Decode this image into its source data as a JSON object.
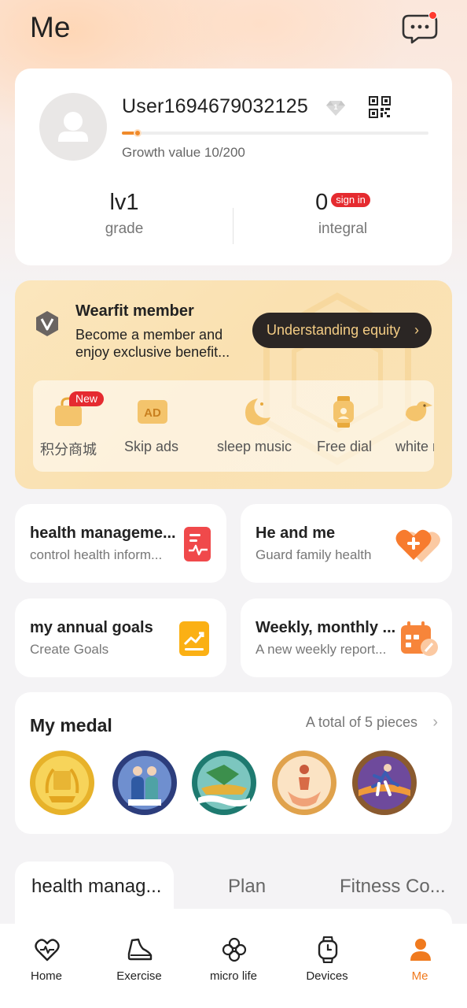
{
  "header": {
    "title": "Me"
  },
  "profile": {
    "username": "User1694679032125",
    "growth_text": "Growth value 10/200",
    "growth_fraction": 0.05,
    "level_value": "lv1",
    "level_label": "grade",
    "integral_value": "0",
    "sign_in_label": "sign in",
    "integral_label": "integral"
  },
  "member": {
    "title": "Wearfit member",
    "description": "Become a member and enjoy exclusive benefit...",
    "equity_button": "Understanding equity",
    "benefits": [
      {
        "label": "积分商城",
        "badge": "New",
        "icon": "shopping-bag-icon"
      },
      {
        "label": "Skip ads",
        "icon": "ad-icon"
      },
      {
        "label": "sleep music",
        "icon": "moon-icon"
      },
      {
        "label": "Free dial",
        "icon": "watch-dial-icon"
      },
      {
        "label": "white no",
        "icon": "bird-icon"
      }
    ]
  },
  "features": [
    {
      "title": "health manageme...",
      "subtitle": "control health inform...",
      "icon": "health-report-icon"
    },
    {
      "title": "He and me",
      "subtitle": "Guard family health",
      "icon": "heart-plus-icon"
    },
    {
      "title": "my annual goals",
      "subtitle": "Create Goals",
      "icon": "trend-chart-icon"
    },
    {
      "title": "Weekly, monthly ...",
      "subtitle": "A new weekly report...",
      "icon": "calendar-report-icon"
    }
  ],
  "medals": {
    "title": "My medal",
    "total": "A total of 5 pieces",
    "items": [
      "gold-laurel-medal-icon",
      "team-medal-icon",
      "dragon-boat-medal-icon",
      "runner-medal-icon",
      "sprinter-medal-icon"
    ]
  },
  "section_tabs": [
    "health manag...",
    "Plan",
    "Fitness Co..."
  ],
  "nav": [
    {
      "label": "Home",
      "icon": "heart-pulse-icon"
    },
    {
      "label": "Exercise",
      "icon": "shoe-icon"
    },
    {
      "label": "micro life",
      "icon": "clover-icon"
    },
    {
      "label": "Devices",
      "icon": "watch-icon"
    },
    {
      "label": "Me",
      "icon": "person-icon"
    }
  ],
  "colors": {
    "accent": "#f07a1e",
    "sign_in": "#e52b30",
    "equity_text": "#f3cc84"
  }
}
